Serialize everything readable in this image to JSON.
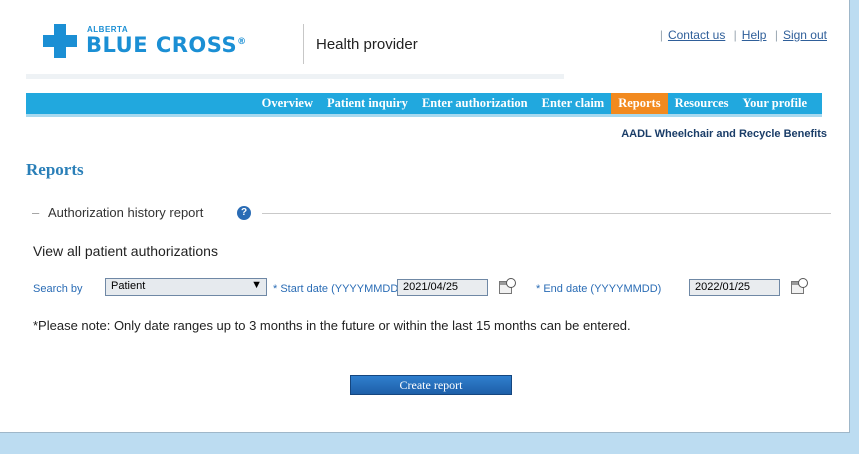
{
  "header": {
    "logo_top": "ALBERTA",
    "logo_main": "BLUE CROSS",
    "logo_reg": "®",
    "site_name": "Health provider",
    "links": [
      "Contact us",
      "Help",
      "Sign out"
    ]
  },
  "nav": {
    "items": [
      {
        "label": "Overview",
        "active": false
      },
      {
        "label": "Patient inquiry",
        "active": false
      },
      {
        "label": "Enter authorization",
        "active": false
      },
      {
        "label": "Enter claim",
        "active": false
      },
      {
        "label": "Reports",
        "active": true
      },
      {
        "label": "Resources",
        "active": false
      },
      {
        "label": "Your profile",
        "active": false
      }
    ],
    "sub_link": "AADL Wheelchair and Recycle Benefits"
  },
  "page": {
    "title": "Reports",
    "section_dash": "–",
    "section_title": "Authorization history report",
    "help_glyph": "?",
    "view_all": "View all patient authorizations"
  },
  "search": {
    "search_by_label": "Search by",
    "search_by_value": "Patient",
    "start_label": "* Start date (YYYYMMDD)",
    "start_value": "2021/04/25",
    "end_label": "* End date (YYYYMMDD)",
    "end_value": "2022/01/25"
  },
  "note": "*Please note: Only date ranges up to 3 months in the future or within the last 15 months can be entered.",
  "actions": {
    "create_report": "Create report"
  },
  "colors": {
    "brand_blue": "#1b8fd4",
    "nav_blue": "#21a8de",
    "nav_active": "#f28a1f",
    "title_blue": "#2a7fb8",
    "background": "#bcdcf1"
  },
  "icons": {
    "help": "help-icon",
    "calendar": "calendar-clock-icon",
    "dropdown": "chevron-down-icon",
    "logo": "blue-cross-logo-icon"
  }
}
